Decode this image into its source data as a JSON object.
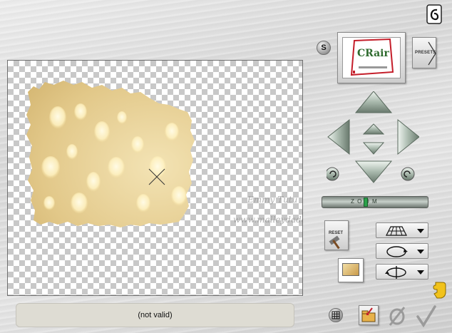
{
  "window": {
    "status_text": "(not valid)"
  },
  "watermark": {
    "line1": "Emmy Tutu",
    "line2": "www.malleydaddy.eu"
  },
  "presets": {
    "label": "PRESETS",
    "thumb_text": "CRair"
  },
  "controls": {
    "s_button_label": "S",
    "reset_label": "RESET",
    "zoom_label": "Z O O M"
  },
  "colors": {
    "accent_green": "#2aa14a",
    "arrow_metal": "#a8b8ac",
    "status_bg": "#dedcd3",
    "preset_red": "#c41e2a"
  }
}
